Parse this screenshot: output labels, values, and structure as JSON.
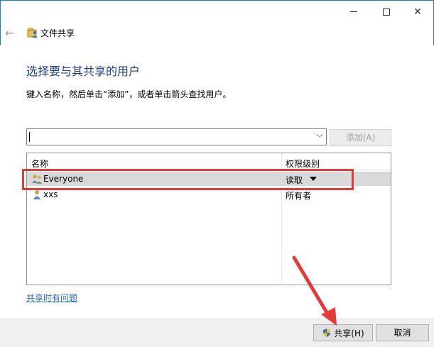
{
  "window": {
    "title": "文件共享",
    "minimize_icon": "minimize-icon",
    "maximize_icon": "maximize-icon",
    "close_icon": "close-icon"
  },
  "nav": {
    "back_icon": "back-arrow-icon"
  },
  "main": {
    "heading": "选择要与其共享的用户",
    "instruction": "键入名称，然后单击“添加”，或者单击箭头查找用户。",
    "name_input_value": "",
    "add_button_label": "添加(A)",
    "list": {
      "headers": {
        "name": "名称",
        "permission": "权限级别"
      },
      "rows": [
        {
          "name": "Everyone",
          "permission": "读取",
          "icon": "group-icon"
        },
        {
          "name": "xxs",
          "permission": "所有者",
          "icon": "user-icon"
        }
      ]
    },
    "help_link": "共享时有问题"
  },
  "footer": {
    "share_button_label": "共享(H)",
    "cancel_button_label": "取消"
  },
  "colors": {
    "accent_border": "#1e7ad8",
    "heading": "#1f3c88",
    "annotation_red": "#e23b3b",
    "link": "#2a6bbd",
    "selected_row": "#d9d9d9"
  }
}
